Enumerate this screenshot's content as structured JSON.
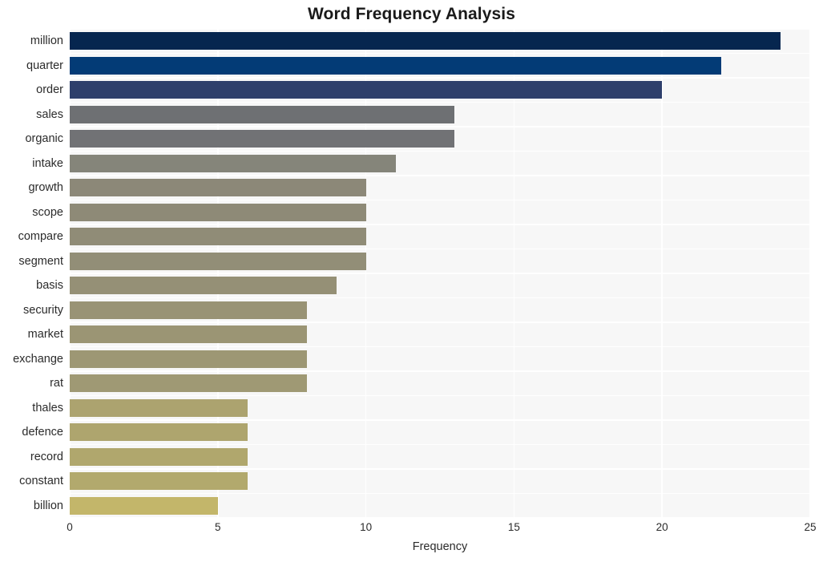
{
  "chart_data": {
    "type": "bar",
    "orientation": "horizontal",
    "title": "Word Frequency Analysis",
    "xlabel": "Frequency",
    "ylabel": "",
    "categories": [
      "million",
      "quarter",
      "order",
      "sales",
      "organic",
      "intake",
      "growth",
      "scope",
      "compare",
      "segment",
      "basis",
      "security",
      "market",
      "exchange",
      "rat",
      "thales",
      "defence",
      "record",
      "constant",
      "billion"
    ],
    "values": [
      24,
      22,
      20,
      13,
      13,
      11,
      10,
      10,
      10,
      10,
      9,
      8,
      8,
      8,
      8,
      6,
      6,
      6,
      6,
      5
    ],
    "bar_colors": [
      "#06264f",
      "#033b76",
      "#2e3f6b",
      "#6e7073",
      "#717275",
      "#85857a",
      "#8c8878",
      "#8e8a77",
      "#908c77",
      "#928e77",
      "#959076",
      "#999375",
      "#9b9574",
      "#9d9774",
      "#9f9974",
      "#aca36f",
      "#aea56e",
      "#b0a76d",
      "#b2a96d",
      "#c3b66a"
    ],
    "xlim": [
      0,
      25
    ],
    "xticks": [
      0,
      5,
      10,
      15,
      20,
      25
    ],
    "xtick_labels": [
      "0",
      "5",
      "10",
      "15",
      "20",
      "25"
    ],
    "grid": true,
    "grid_color": "#ffffff",
    "plot_background": "#f7f7f7",
    "figure_background": "#ffffff",
    "legend": null
  }
}
